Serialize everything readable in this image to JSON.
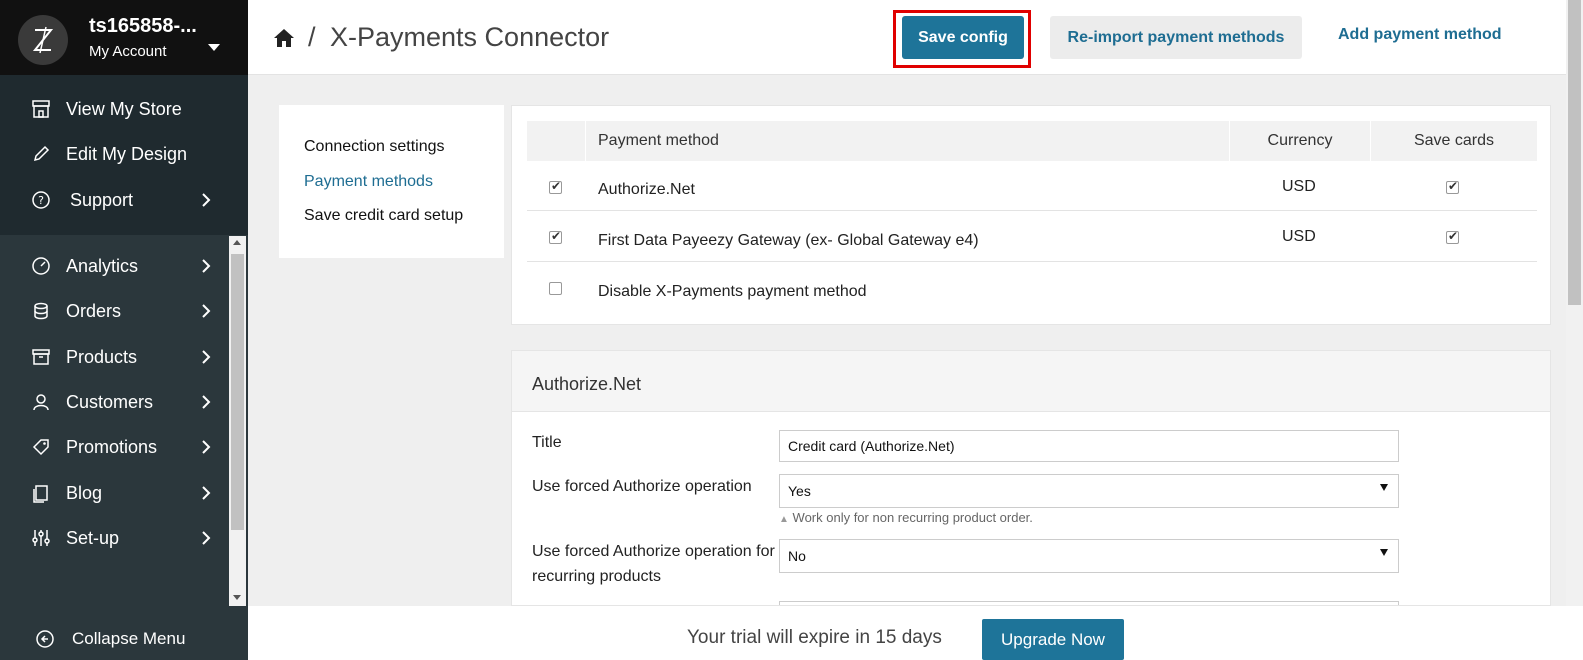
{
  "account": {
    "name": "ts165858-...",
    "sub": "My Account"
  },
  "top_nav": [
    {
      "label": "View My Store",
      "icon": "store-icon"
    },
    {
      "label": "Edit My Design",
      "icon": "pencil-icon"
    },
    {
      "label": "Support",
      "icon": "question-icon"
    }
  ],
  "main_nav": [
    {
      "label": "Analytics",
      "icon": "gauge-icon"
    },
    {
      "label": "Orders",
      "icon": "database-icon"
    },
    {
      "label": "Products",
      "icon": "archive-icon"
    },
    {
      "label": "Customers",
      "icon": "user-icon"
    },
    {
      "label": "Promotions",
      "icon": "tags-icon"
    },
    {
      "label": "Blog",
      "icon": "document-icon"
    },
    {
      "label": "Set-up",
      "icon": "sliders-icon"
    }
  ],
  "collapse_label": "Collapse Menu",
  "header": {
    "separator": "/",
    "title": "X-Payments Connector",
    "save_label": "Save config",
    "reimport_label": "Re-import payment methods",
    "add_label": "Add payment method"
  },
  "subnav": {
    "items": [
      "Connection settings",
      "Payment methods",
      "Save credit card setup"
    ],
    "active": "Payment methods"
  },
  "methods_table": {
    "columns": [
      "Payment method",
      "Currency",
      "Save cards"
    ],
    "rows": [
      {
        "enabled": true,
        "name": "Authorize.Net",
        "currency": "USD",
        "save_cards": true
      },
      {
        "enabled": true,
        "name": "First Data Payeezy Gateway (ex- Global Gateway e4)",
        "currency": "USD",
        "save_cards": true
      },
      {
        "enabled": false,
        "name": "Disable X-Payments payment method",
        "currency": "",
        "save_cards": null
      }
    ]
  },
  "auth_section": {
    "title": "Authorize.Net",
    "fields": [
      {
        "label": "Title",
        "value": "Credit card (Authorize.Net)"
      },
      {
        "label": "Use forced Authorize operation",
        "value": "Yes",
        "hint": "Work only for non recurring product order."
      },
      {
        "label": "Use forced Authorize operation for recurring products",
        "value": "No"
      }
    ]
  },
  "trial": {
    "text": "Your trial will expire in 15 days",
    "button": "Upgrade Now"
  },
  "colors": {
    "accent": "#1e7499",
    "link": "#1e6d92",
    "sidebar": "#2b373c",
    "highlight": "#e00000"
  }
}
